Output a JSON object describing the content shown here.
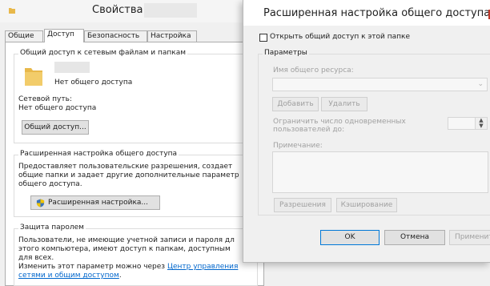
{
  "properties": {
    "title": "Свойства:",
    "tabs": [
      "Общие",
      "Доступ",
      "Безопасность",
      "Настройка"
    ],
    "network_sharing": {
      "group_title": "Общий доступ к сетевым файлам и папкам",
      "status": "Нет общего доступа",
      "path_label": "Сетевой путь:",
      "path_value": "Нет общего доступа",
      "share_button": "Общий доступ..."
    },
    "advanced_sharing": {
      "group_title": "Расширенная настройка общего доступа",
      "description": [
        "Предоставляет пользовательские разрешения, создает",
        "общие папки и задает другие дополнительные параметр",
        "общего доступа."
      ],
      "button": "Расширенная настройка..."
    },
    "password_protection": {
      "group_title": "Защита паролем",
      "description": [
        "Пользователи, не имеющие учетной записи и пароля дл",
        "этого компьютера, имеют доступ к папкам, доступным",
        "для всех."
      ],
      "change_prefix": "Изменить этот параметр можно через",
      "link_line1": "Центр управления",
      "link_line2": "сетями и общим доступом",
      "link_suffix": "."
    }
  },
  "advanced_dialog": {
    "title": "Расширенная настройка общего доступа",
    "share_checkbox_label": "Открыть общий доступ к этой папке",
    "share_checked": false,
    "params_title": "Параметры",
    "share_name_label": "Имя общего ресурса:",
    "add_button": "Добавить",
    "remove_button": "Удалить",
    "limit_label_line1": "Ограничить число одновременных",
    "limit_label_line2": "пользователей до:",
    "note_label": "Примечание:",
    "permissions_button": "Разрешения",
    "caching_button": "Кэширование",
    "ok_button": "OK",
    "cancel_button": "Отмена",
    "apply_button": "Применить"
  },
  "colors": {
    "folder": "#e8b84a",
    "link": "#0066cc",
    "ok_border": "#0078d7"
  }
}
